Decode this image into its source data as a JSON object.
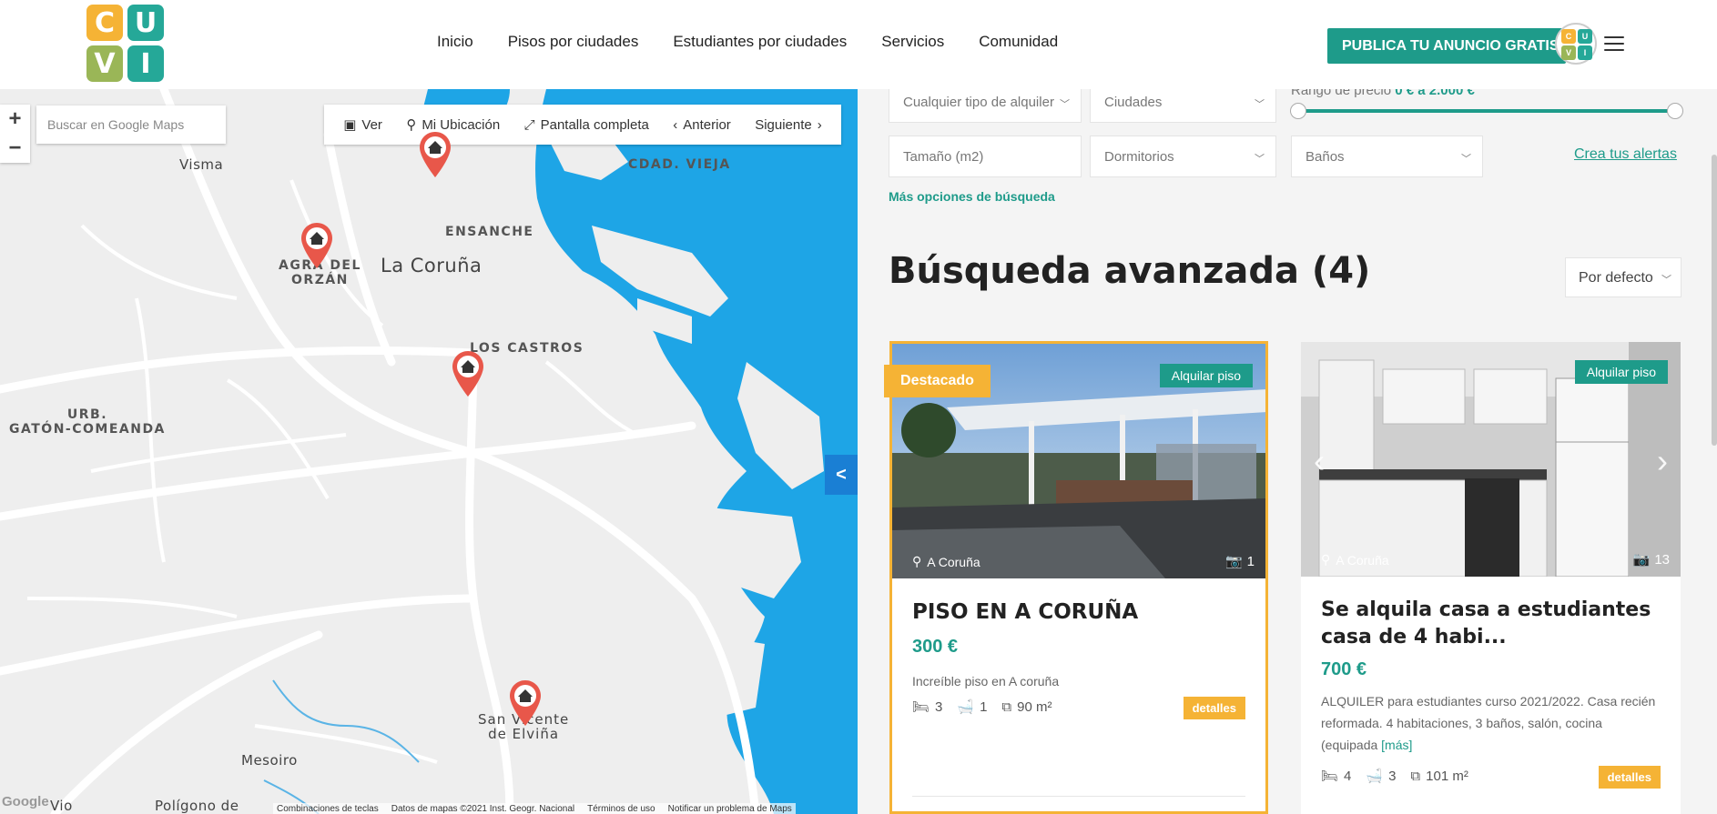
{
  "header": {
    "logo_letters": [
      "C",
      "U",
      "V",
      "I"
    ],
    "nav": [
      "Inicio",
      "Pisos por ciudades",
      "Estudiantes por ciudades",
      "Servicios",
      "Comunidad"
    ],
    "cta_label": "PUBLICA TU ANUNCIO GRATIS"
  },
  "map": {
    "search_placeholder": "Buscar en Google Maps",
    "zoom_in": "+",
    "zoom_out": "−",
    "toolbar": {
      "view": "Ver",
      "my_location": "Mi Ubicación",
      "fullscreen": "Pantalla completa",
      "previous": "Anterior",
      "next": "Siguiente"
    },
    "labels": {
      "visma": "Visma",
      "cdad_vieja": "CDAD. VIEJA",
      "ensanche": "ENSANCHE",
      "coruna": "La Coruña",
      "agra": "AGRA DEL\nORZÁN",
      "castros": "LOS CASTROS",
      "urb": "URB.\nGATÓN-COMEANDA",
      "sanvicente": "San Vicente\nde Elviña",
      "mesoiro": "Mesoiro",
      "poligono": "Polígono de",
      "vio": "Vio"
    },
    "collapse_label": "<",
    "google": "Google",
    "footer": [
      "Combinaciones de teclas",
      "Datos de mapas ©2021 Inst. Geogr. Nacional",
      "Términos de uso",
      "Notificar un problema de Maps"
    ],
    "colors": {
      "water": "#1ea5e6",
      "land": "#eeeeee",
      "road": "#ffffff",
      "pin": "#e8574a"
    }
  },
  "filters": {
    "rent_type": "Cualquier tipo de alquiler",
    "cities": "Ciudades",
    "price_label": "Rango de precio",
    "price_range": "0 € a 2.000 €",
    "size": "Tamaño (m2)",
    "bedrooms": "Dormitorios",
    "bathrooms": "Baños",
    "alerts_link": "Crea tus alertas",
    "more_options": "Más opciones de búsqueda"
  },
  "results": {
    "title": "Búsqueda avanzada (4)",
    "sort": "Por defecto"
  },
  "cards": [
    {
      "featured_badge": "Destacado",
      "rent_badge": "Alquilar piso",
      "location": "A Coruña",
      "photos": "1",
      "title": "PISO EN A CORUÑA",
      "price": "300 €",
      "description": "Increíble piso en A coruña",
      "beds": "3",
      "baths": "1",
      "area": "90 m²",
      "details": "detalles"
    },
    {
      "rent_badge": "Alquilar piso",
      "location": "A Coruña",
      "photos": "13",
      "title": "Se alquila casa a estudiantes casa de 4 habi...",
      "price": "700 €",
      "description": "ALQUILER para estudiantes curso 2021/2022. Casa recién reformada. 4 habitaciones, 3 baños, salón, cocina (equipada",
      "more": "[más]",
      "beds": "4",
      "baths": "3",
      "area": "101 m²",
      "details": "detalles"
    }
  ],
  "accent_colors": {
    "teal": "#1e9b8a",
    "yellow": "#f5b335"
  }
}
